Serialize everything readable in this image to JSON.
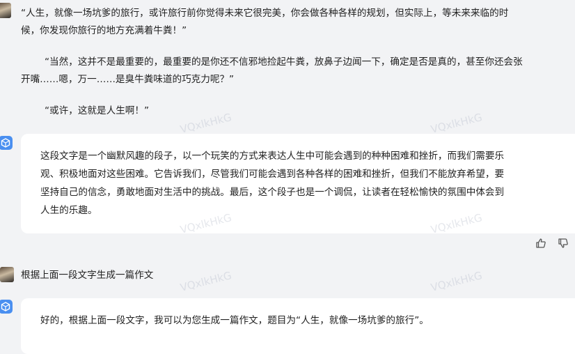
{
  "conversation": {
    "prev_answer": {
      "lines": [
        "“人生，就像一场坑爹的旅行，或许旅行前你觉得未来它很完美，你会做各种各样的规划，但实际上，等未来来临的时",
        "候，你发现你旅行的地方充满着牛粪！”",
        "“当然，这并不是最重要的，最重要的是你还不信邪地捡起牛粪，放鼻子边闻一下，确定是否是真的，甚至你还会张",
        "开嘴……嗯，万一……是臭牛粪味道的巧克力呢？”",
        "“或许，这就是人生啊！”"
      ]
    },
    "bot_reply_1": {
      "lines": [
        "这段文字是一个幽默风趣的段子，以一个玩笑的方式来表达人生中可能会遇到的种种困难和挫折，而我们需要乐",
        "观、积极地面对这些困难。它告诉我们，尽管我们可能会遇到各种各样的困难和挫折，但我们不能放弃希望，要",
        "坚持自己的信念，勇敢地面对生活中的挑战。最后，这个段子也是一个调侃，让读者在轻松愉快的氛围中体会到",
        "人生的乐趣。"
      ]
    },
    "user_message": "根据上面一段文字生成一篇作文",
    "bot_reply_2": {
      "text": "好的，根据上面一段文字，我可以为您生成一篇作文，题目为“人生，就像一场坑爹的旅行”。"
    },
    "icons": {
      "like": "thumbs-up-icon",
      "dislike": "thumbs-down-icon",
      "bot": "cube-logo-icon"
    }
  },
  "watermark": "VQxlkHkG"
}
